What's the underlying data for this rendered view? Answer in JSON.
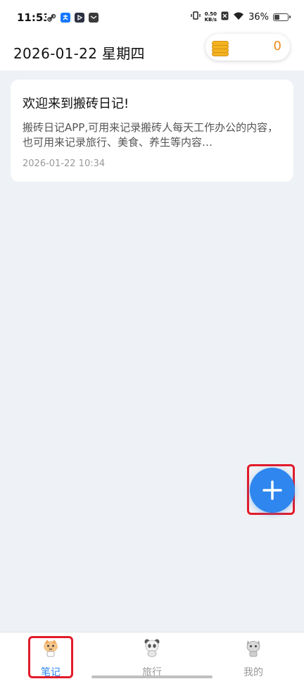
{
  "status_bar": {
    "time": "11:53",
    "net_speed_value": "0.50",
    "net_speed_unit": "KB/s",
    "battery": "36%"
  },
  "header": {
    "date": "2026-01-22 星期四",
    "coins": "0"
  },
  "notes": [
    {
      "title": "欢迎来到搬砖日记!",
      "content": "搬砖日记APP,可用来记录搬砖人每天工作办公的内容，也可用来记录旅行、美食、养生等内容…",
      "time": "2026-01-22 10:34"
    }
  ],
  "fab": {
    "icon": "plus-icon"
  },
  "bottom_nav": [
    {
      "label": "笔记",
      "icon": "notes-mascot-icon",
      "active": true
    },
    {
      "label": "旅行",
      "icon": "panda-icon",
      "active": false
    },
    {
      "label": "我的",
      "icon": "cat-icon",
      "active": false
    }
  ],
  "colors": {
    "accent": "#2e86ee",
    "highlight": "#e21b2a",
    "coin": "#f08a1a"
  }
}
